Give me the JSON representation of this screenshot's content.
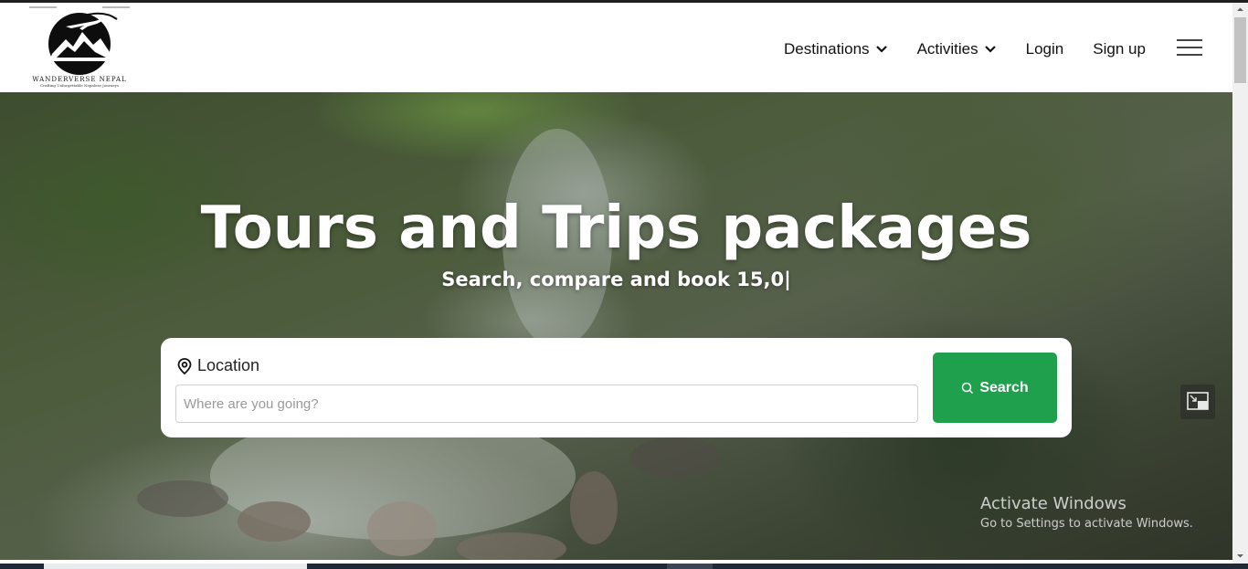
{
  "brand": {
    "name": "WANDERVERSE NEPAL",
    "tagline": "Crafting Unforgettable Nepalese Journeys"
  },
  "nav": {
    "items": [
      {
        "label": "Destinations",
        "has_dropdown": true
      },
      {
        "label": "Activities",
        "has_dropdown": true
      },
      {
        "label": "Login",
        "has_dropdown": false
      },
      {
        "label": "Sign up",
        "has_dropdown": false
      }
    ],
    "menu_icon": "hamburger-menu-icon"
  },
  "hero": {
    "title": "Tours and Trips packages",
    "subtitle": "Search, compare and book 15,0|"
  },
  "search": {
    "location_label": "Location",
    "location_icon": "map-pin-icon",
    "placeholder": "Where are you going?",
    "value": "",
    "button_label": "Search",
    "button_icon": "search-icon",
    "button_color": "#1fa04c"
  },
  "watermark": {
    "title": "Activate Windows",
    "subtitle": "Go to Settings to activate Windows."
  }
}
